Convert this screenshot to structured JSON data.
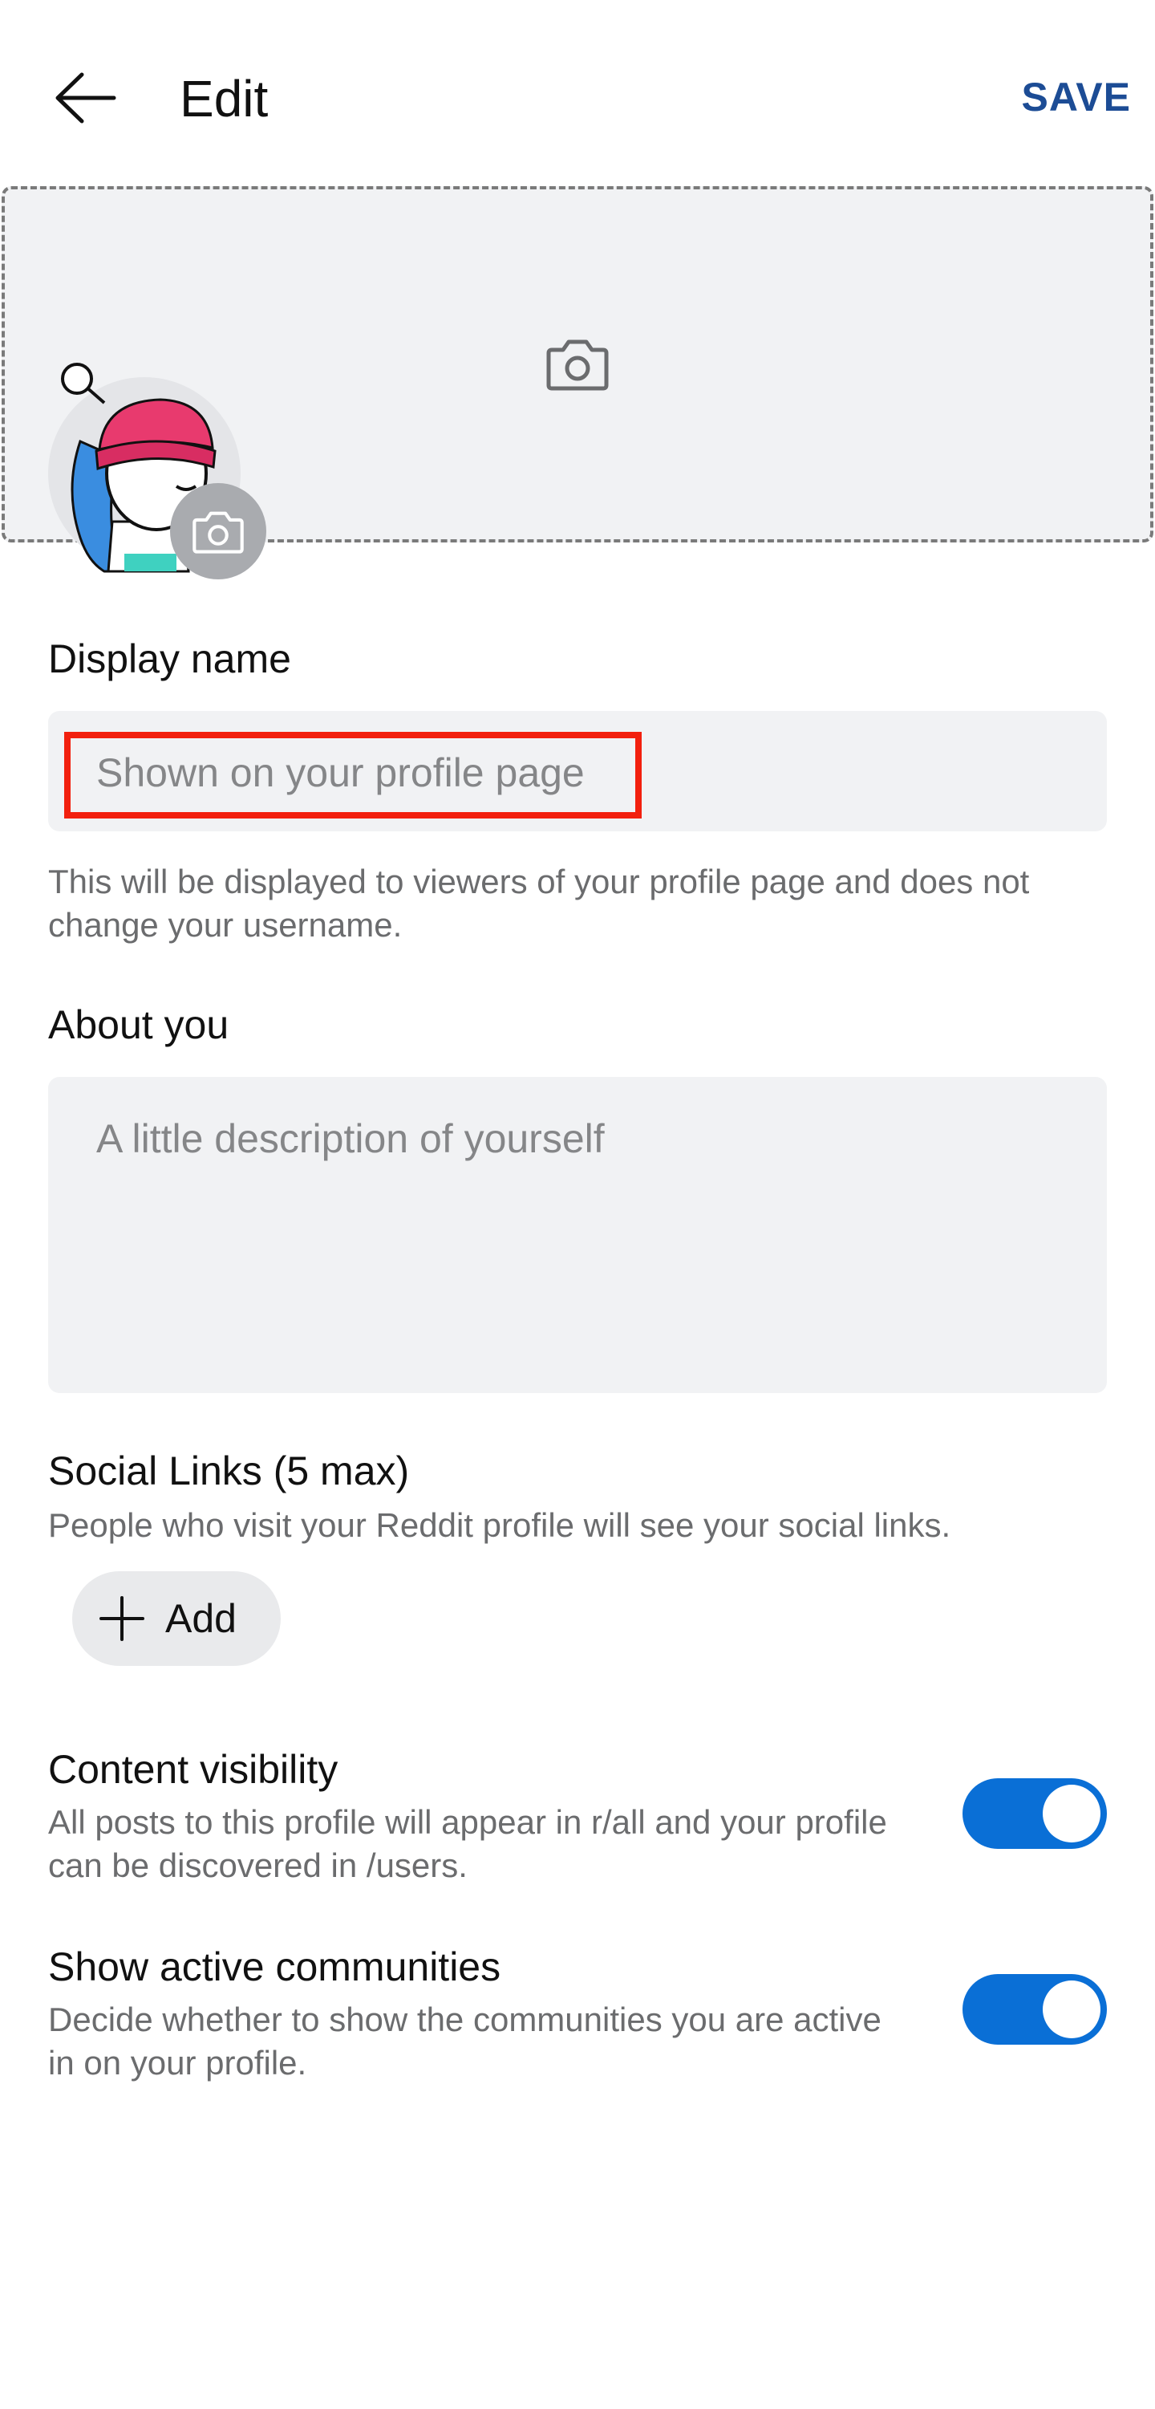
{
  "header": {
    "title": "Edit",
    "save_label": "SAVE"
  },
  "display_name": {
    "label": "Display name",
    "placeholder": "Shown on your profile page",
    "help": "This will be displayed to viewers of your profile page and does not change your username."
  },
  "about": {
    "label": "About you",
    "placeholder": "A little description of yourself"
  },
  "social_links": {
    "label": "Social Links (5 max)",
    "help": "People who visit your Reddit profile will see your social links.",
    "add_label": "Add"
  },
  "content_visibility": {
    "label": "Content visibility",
    "description": "All posts to this profile will appear in r/all and your profile can be discovered in /users.",
    "enabled": true
  },
  "active_communities": {
    "label": "Show active communities",
    "description": "Decide whether to show the communities you are active in on your profile.",
    "enabled": true
  },
  "colors": {
    "accent": "#0a6fd6",
    "save": "#1c4c95",
    "highlight": "#f2200e"
  },
  "icons": {
    "back": "arrow-left-icon",
    "banner_camera": "camera-icon",
    "avatar_camera": "camera-icon",
    "add": "plus-icon"
  }
}
